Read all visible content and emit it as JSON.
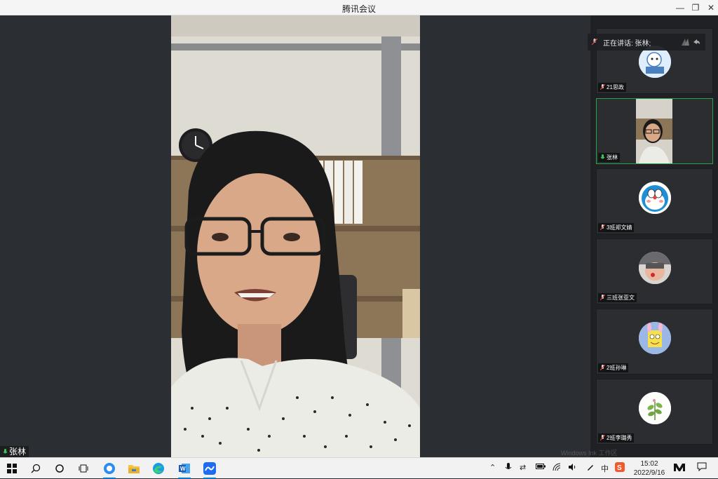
{
  "window": {
    "title": "腾讯会议"
  },
  "main_video": {
    "participant": "张林"
  },
  "speaking": {
    "label": "正在讲话: 张林;"
  },
  "participants": [
    {
      "name": "21思政",
      "avatar": "cartoon-cat-avatar"
    },
    {
      "name": "张林",
      "avatar": "video-thumbnail",
      "active": true
    },
    {
      "name": "3班郑文婧",
      "avatar": "doraemon-avatar"
    },
    {
      "name": "三班张亚文",
      "avatar": "child-photo-avatar"
    },
    {
      "name": "2班孙琳",
      "avatar": "spongebob-avatar"
    },
    {
      "name": "2班李璐秀",
      "avatar": "plant-avatar"
    }
  ],
  "taskbar": {
    "ime_label": "中",
    "time": "15:02",
    "date": "2022/9/16"
  },
  "watermark": "Windows Ink 工作区",
  "colors": {
    "active_border": "#27a34a",
    "mic_green": "#3ec14e",
    "mic_red": "#e0453b"
  }
}
